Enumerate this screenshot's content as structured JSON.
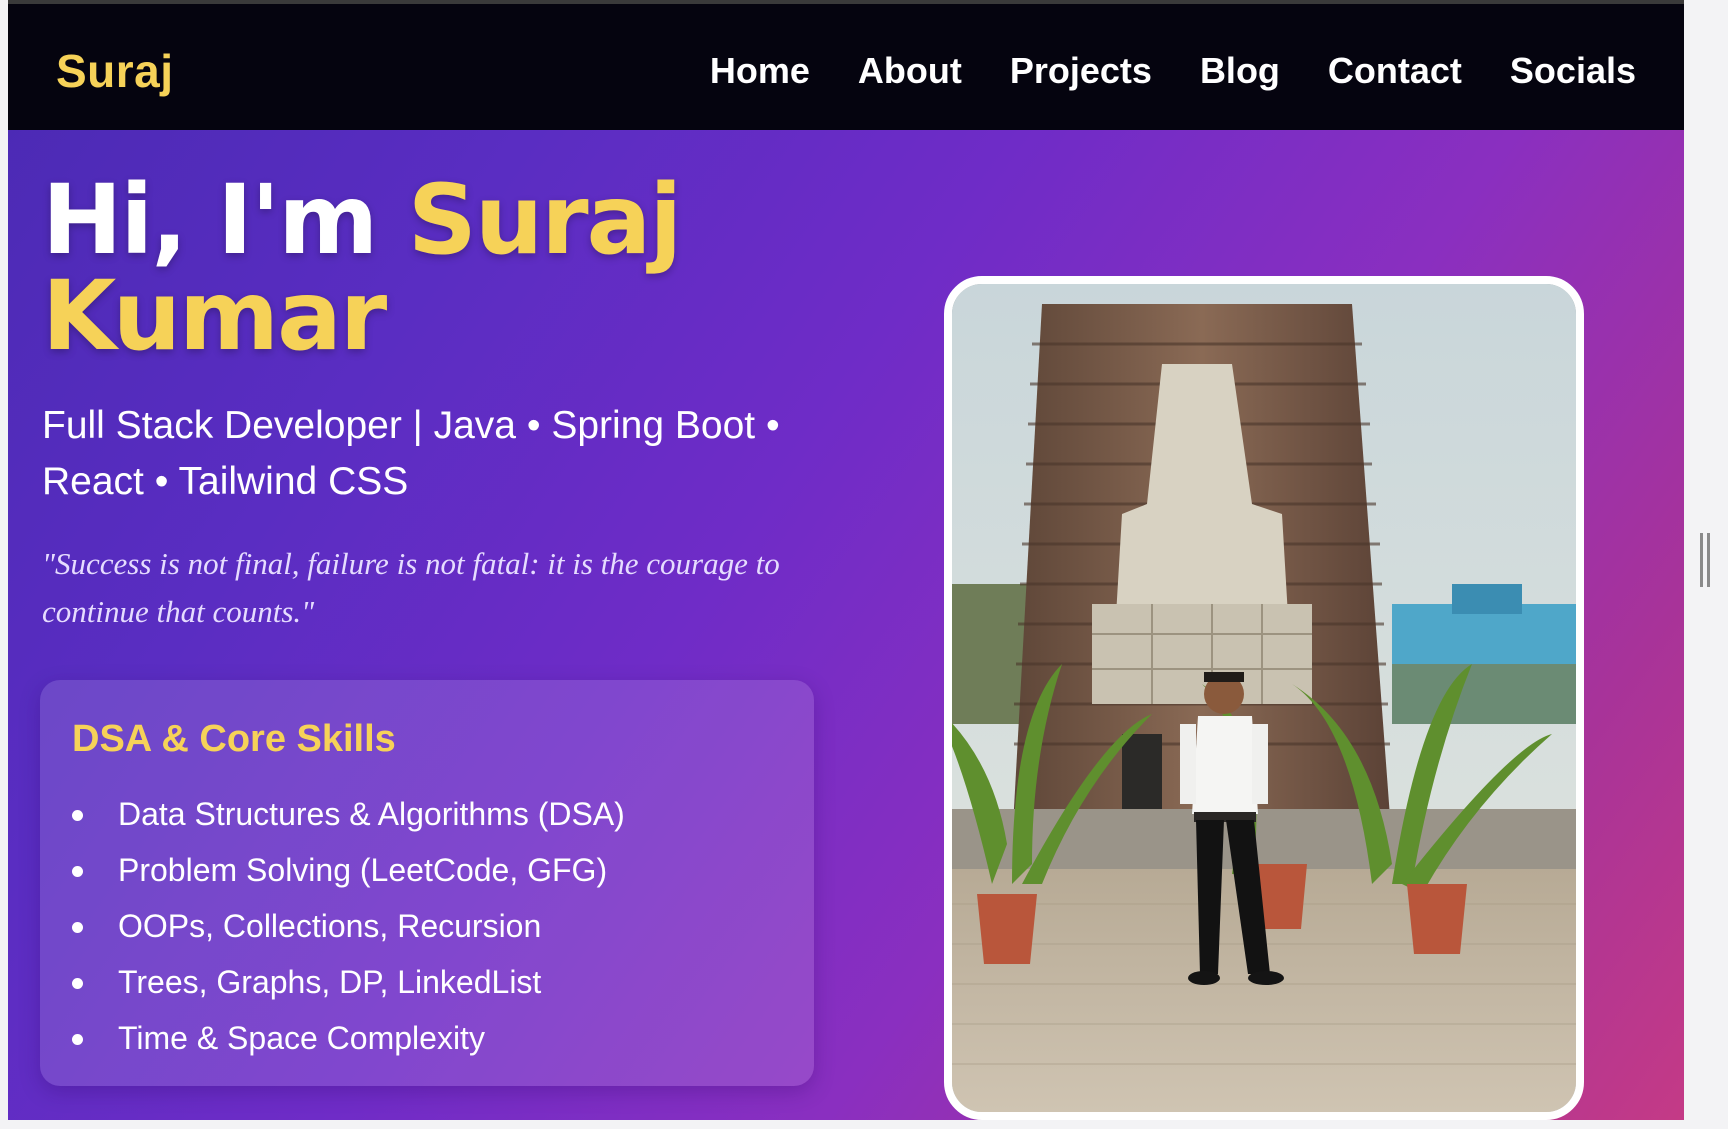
{
  "header": {
    "brand": "Suraj",
    "nav": [
      "Home",
      "About",
      "Projects",
      "Blog",
      "Contact",
      "Socials"
    ]
  },
  "hero": {
    "greeting": "Hi, I'm ",
    "name_first": "Suraj",
    "name_last": "Kumar",
    "subtitle": "Full Stack Developer | Java • Spring Boot • React • Tailwind CSS",
    "quote": "\"Success is not final, failure is not fatal: it is the courage to continue that counts.\""
  },
  "skills": {
    "title": "DSA & Core Skills",
    "items": [
      "Data Structures & Algorithms (DSA)",
      "Problem Solving (LeetCode, GFG)",
      "OOPs, Collections, Recursion",
      "Trees, Graphs, DP, LinkedList",
      "Time & Space Complexity"
    ]
  },
  "colors": {
    "accent": "#f6d258",
    "navbar": "#05040f",
    "gradient_start": "#4a2ab3",
    "gradient_end": "#c43a86"
  }
}
